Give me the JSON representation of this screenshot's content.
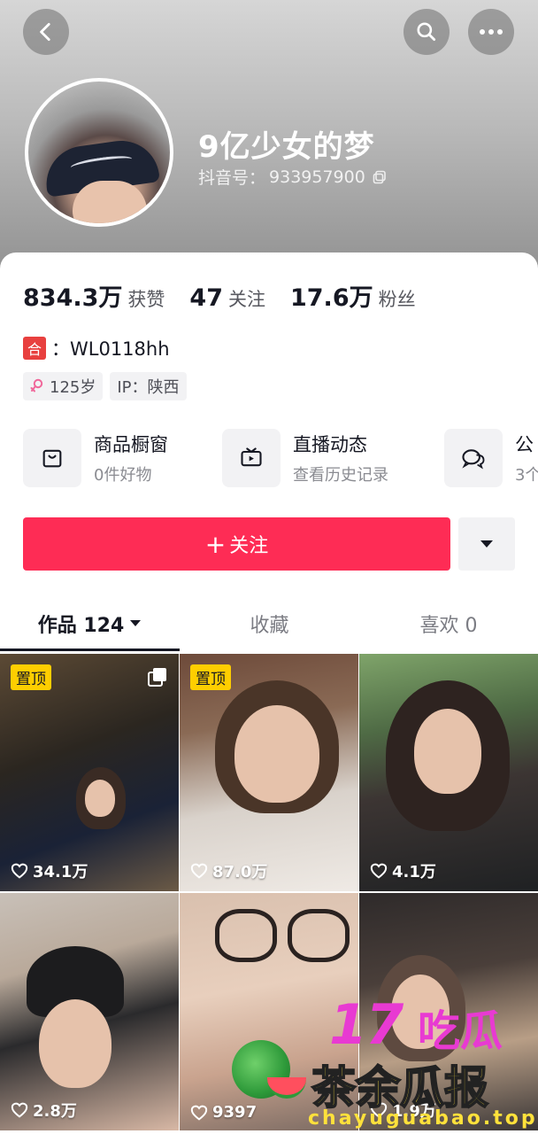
{
  "profile": {
    "nickname": "9亿少女的梦",
    "account_label": "抖音号：",
    "account_id": "933957900"
  },
  "stats": [
    {
      "value": "834.3万",
      "label": "获赞"
    },
    {
      "value": "47",
      "label": "关注"
    },
    {
      "value": "17.6万",
      "label": "粉丝"
    }
  ],
  "tag": {
    "badge": "合",
    "text": "：WL0118hh"
  },
  "chips": {
    "age": "125岁",
    "ip": "IP：陕西"
  },
  "services": [
    {
      "title": "商品橱窗",
      "subtitle": "0件好物",
      "icon": "shopping-bag-icon"
    },
    {
      "title": "直播动态",
      "subtitle": "查看历史记录",
      "icon": "tv-icon"
    },
    {
      "title": "公",
      "subtitle": "3个",
      "icon": "chat-bubbles-icon"
    }
  ],
  "actions": {
    "follow_label": "关注",
    "follow_prefix": "+"
  },
  "tabs": [
    {
      "label": "作品 124",
      "active": true
    },
    {
      "label": "收藏",
      "active": false
    },
    {
      "label": "喜欢 0",
      "active": false
    }
  ],
  "videos": [
    {
      "likes": "34.1万",
      "pinned": true,
      "pin_label": "置顶",
      "multi": true
    },
    {
      "likes": "87.0万",
      "pinned": true,
      "pin_label": "置顶",
      "multi": false
    },
    {
      "likes": "4.1万",
      "pinned": false,
      "multi": false
    },
    {
      "likes": "2.8万",
      "pinned": false,
      "multi": false
    },
    {
      "likes": "9397",
      "pinned": false,
      "multi": false
    },
    {
      "likes": "1.9万",
      "pinned": false,
      "multi": false
    }
  ],
  "watermark": {
    "number": "17",
    "top_text": "吃瓜",
    "main_text": "茶余瓜报",
    "url": "chayuguabao.top"
  },
  "colors": {
    "accent": "#fe2c55",
    "pin": "#fece00",
    "tag_red": "#e8403f"
  }
}
